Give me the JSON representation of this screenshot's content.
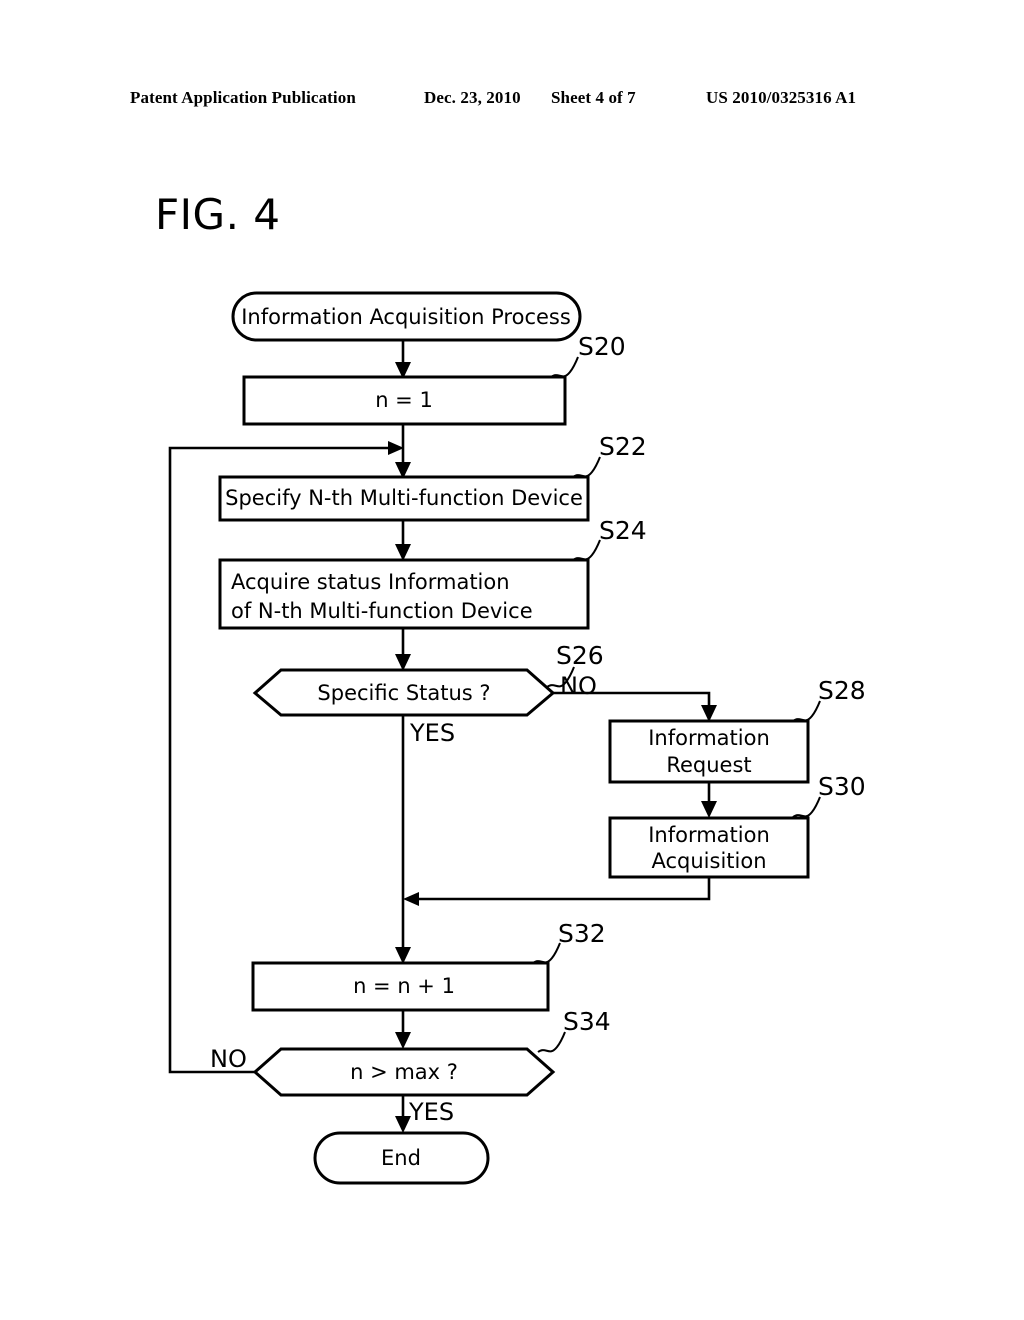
{
  "header": {
    "publication": "Patent Application Publication",
    "date": "Dec. 23, 2010",
    "sheet": "Sheet 4 of 7",
    "patent_number": "US 2010/0325316 A1"
  },
  "figure": {
    "title": "FIG. 4"
  },
  "flowchart": {
    "nodes": {
      "start": {
        "label": "Information Acquisition Process",
        "shape": "terminator"
      },
      "s20": {
        "label": "n = 1",
        "shape": "process",
        "step": "S20"
      },
      "s22": {
        "label": "Specify N-th Multi-function Device",
        "shape": "process",
        "step": "S22"
      },
      "s24": {
        "line1": "Acquire status Information",
        "line2": "of N-th Multi-function Device",
        "shape": "process",
        "step": "S24"
      },
      "s26": {
        "label": "Specific Status ?",
        "shape": "decision",
        "step": "S26"
      },
      "s28": {
        "line1": "Information",
        "line2": "Request",
        "shape": "process",
        "step": "S28"
      },
      "s30": {
        "line1": "Information",
        "line2": "Acquisition",
        "shape": "process",
        "step": "S30"
      },
      "s32": {
        "label": "n = n + 1",
        "shape": "process",
        "step": "S32"
      },
      "s34": {
        "label": "n > max ?",
        "shape": "decision",
        "step": "S34"
      },
      "end": {
        "label": "End",
        "shape": "terminator"
      }
    },
    "branch_labels": {
      "s26_no": "NO",
      "s26_yes": "YES",
      "s34_no": "NO",
      "s34_yes": "YES"
    },
    "colors": {
      "stroke": "#000000",
      "fill": "#ffffff",
      "background": "#ffffff"
    }
  }
}
